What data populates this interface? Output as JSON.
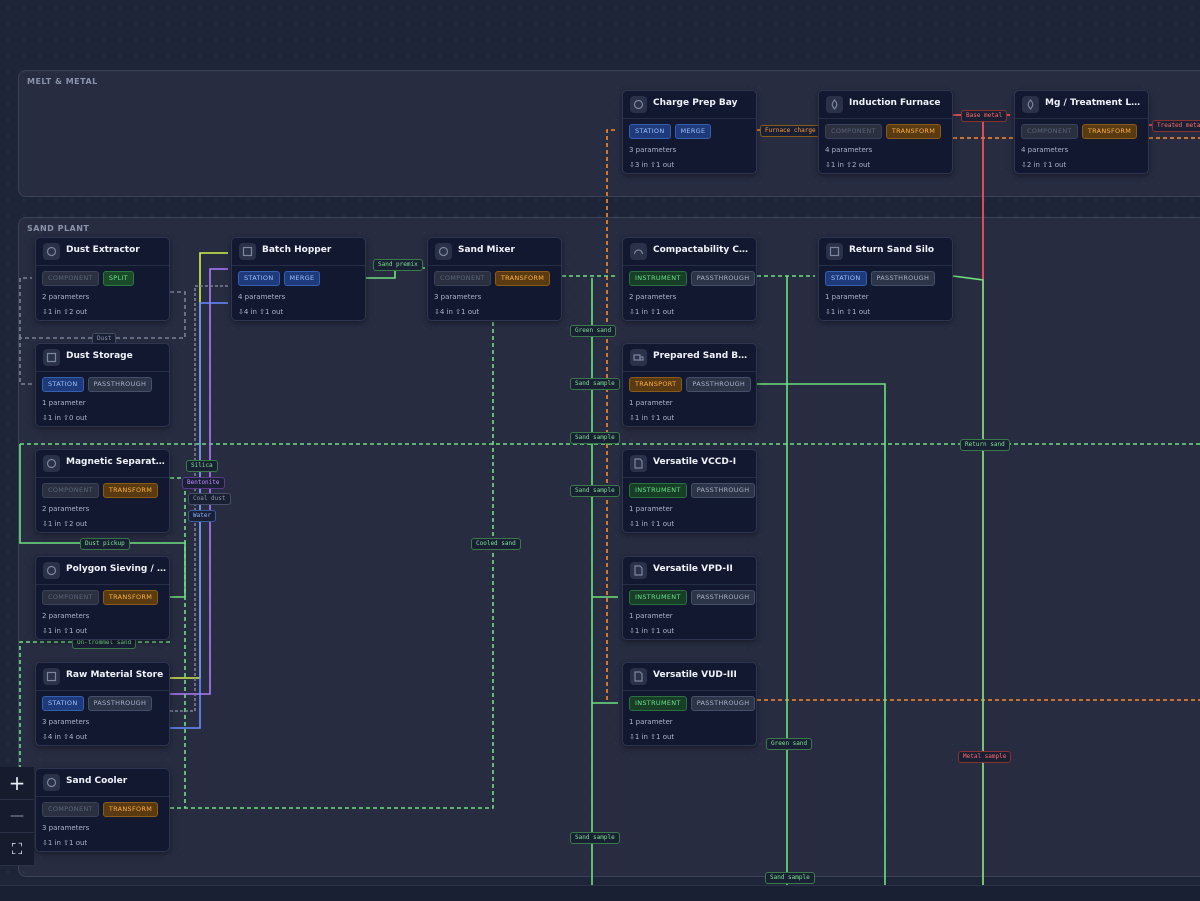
{
  "groups": {
    "melt": "MELT & METAL",
    "sand": "SAND PLANT"
  },
  "nodes": {
    "charge_prep_bay": {
      "title": "Charge Prep Bay",
      "badge1": "STATION",
      "badge2": "MERGE",
      "params": "3 parameters",
      "io": "⇩3 in ⇧1 out"
    },
    "induction_furnace": {
      "title": "Induction Furnace",
      "badge1": "COMPONENT",
      "badge2": "TRANSFORM",
      "params": "4 parameters",
      "io": "⇩1 in ⇧2 out"
    },
    "mg_ladle": {
      "title": "Mg / Treatment Ladle",
      "badge1": "COMPONENT",
      "badge2": "TRANSFORM",
      "params": "4 parameters",
      "io": "⇩2 in ⇧1 out"
    },
    "dust_extractor": {
      "title": "Dust Extractor",
      "badge1": "COMPONENT",
      "badge2": "SPLIT",
      "params": "2 parameters",
      "io": "⇩1 in ⇧2 out"
    },
    "batch_hopper": {
      "title": "Batch Hopper",
      "badge1": "STATION",
      "badge2": "MERGE",
      "params": "4 parameters",
      "io": "⇩4 in ⇧1 out"
    },
    "sand_mixer": {
      "title": "Sand Mixer",
      "badge1": "COMPONENT",
      "badge2": "TRANSFORM",
      "params": "3 parameters",
      "io": "⇩4 in ⇧1 out"
    },
    "compactability": {
      "title": "Compactability Cont...",
      "badge1": "INSTRUMENT",
      "badge2": "PASSTHROUGH",
      "params": "2 parameters",
      "io": "⇩1 in ⇧1 out"
    },
    "return_sand_silo": {
      "title": "Return Sand Silo",
      "badge1": "STATION",
      "badge2": "PASSTHROUGH",
      "params": "1 parameter",
      "io": "⇩1 in ⇧1 out"
    },
    "dust_storage": {
      "title": "Dust Storage",
      "badge1": "STATION",
      "badge2": "PASSTHROUGH",
      "params": "1 parameter",
      "io": "⇩1 in ⇧0 out"
    },
    "prepared_sand_bunker": {
      "title": "Prepared Sand Bunker",
      "badge1": "TRANSPORT",
      "badge2": "PASSTHROUGH",
      "params": "1 parameter",
      "io": "⇩1 in ⇧1 out"
    },
    "magnetic_separator": {
      "title": "Magnetic Separator",
      "badge1": "COMPONENT",
      "badge2": "TRANSFORM",
      "params": "2 parameters",
      "io": "⇩1 in ⇧2 out"
    },
    "vccd": {
      "title": "Versatile VCCD-I",
      "badge1": "INSTRUMENT",
      "badge2": "PASSTHROUGH",
      "params": "1 parameter",
      "io": "⇩1 in ⇧1 out"
    },
    "polygon": {
      "title": "Polygon Sieving / Lu...",
      "badge1": "COMPONENT",
      "badge2": "TRANSFORM",
      "params": "2 parameters",
      "io": "⇩1 in ⇧1 out"
    },
    "vpd": {
      "title": "Versatile VPD-II",
      "badge1": "INSTRUMENT",
      "badge2": "PASSTHROUGH",
      "params": "1 parameter",
      "io": "⇩1 in ⇧1 out"
    },
    "raw_material_store": {
      "title": "Raw Material Store",
      "badge1": "STATION",
      "badge2": "PASSTHROUGH",
      "params": "3 parameters",
      "io": "⇩4 in ⇧4 out"
    },
    "vud": {
      "title": "Versatile VUD-III",
      "badge1": "INSTRUMENT",
      "badge2": "PASSTHROUGH",
      "params": "1 parameter",
      "io": "⇩1 in ⇧1 out"
    },
    "sand_cooler": {
      "title": "Sand Cooler",
      "badge1": "COMPONENT",
      "badge2": "TRANSFORM",
      "params": "3 parameters",
      "io": "⇩1 in ⇧1 out"
    }
  },
  "edge_labels": {
    "furnace_charge": "Furnace charge",
    "base_metal": "Base metal",
    "treated_metal": "Treated meta",
    "sand_premix": "Sand premix",
    "dust": "Dust",
    "green_sand_1": "Green sand",
    "sand_sample_1": "Sand sample",
    "sand_sample_2": "Sand sample",
    "return_sand": "Return sand",
    "silica": "Silica",
    "bentonite": "Bentonite",
    "carbon": "Coal dust",
    "water": "Water",
    "sand_sample_3": "Sand sample",
    "cooled_sand": "Cooled sand",
    "dust_pickup": "Dust pickup",
    "on_trommel_sand": "On-trommel sand",
    "green_sand_2": "Green sand",
    "metal_sample": "Metal sample",
    "sand_sample_4": "Sand sample",
    "sand_sample_5": "Sand sample"
  },
  "controls": {
    "zoom_in": "+",
    "zoom_out": "—",
    "fit_view": "⛶"
  },
  "colors": {
    "sand_flow": "#6ee07f",
    "metal_flow": "#ff8a2a",
    "hot_metal": "#ff5a5a",
    "silica": "#d4f04a",
    "bentonite": "#b07aff",
    "water": "#6a8cff"
  }
}
